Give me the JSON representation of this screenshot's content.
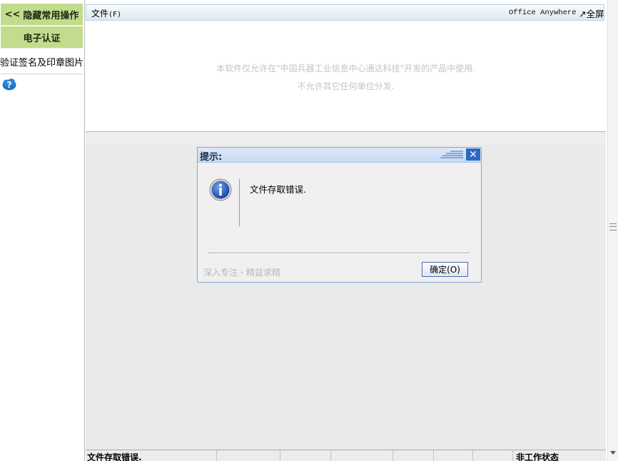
{
  "sidebar": {
    "hide_ops_label": "隐藏常用操作",
    "hide_ops_chevron": "<<",
    "ecert_label": "电子认证",
    "verify_label": "验证签名及印章图片"
  },
  "menubar": {
    "file_label": "文件",
    "file_accel": "(F)",
    "office_anywhere": "Office Anywhere",
    "fullscreen_label": "↗全屏"
  },
  "document": {
    "notice_line1": "本软件仅允许在\"中国兵器工业信息中心通达科技\"开发的产品中使用.",
    "notice_line2": "不允许其它任何单位分发."
  },
  "status": {
    "left_text": "文件存取错误.",
    "right_text": "非工作状态"
  },
  "dialog": {
    "title": "提示:",
    "close_glyph": "✕",
    "message": "文件存取错误.",
    "slogan": "深入专注・精益求精",
    "ok_label": "确定(O)"
  },
  "colors": {
    "sidebar_green": "#c2dc8e",
    "dialog_border": "#7fa9dd",
    "close_blue": "#2f68c2",
    "menubar_top": "#f8fbfd",
    "menubar_bottom": "#dce9f3"
  },
  "icons": {
    "help": "help-cloud-icon",
    "info": "info-icon",
    "close": "close-icon",
    "chevron": "double-chevron-left-icon"
  }
}
